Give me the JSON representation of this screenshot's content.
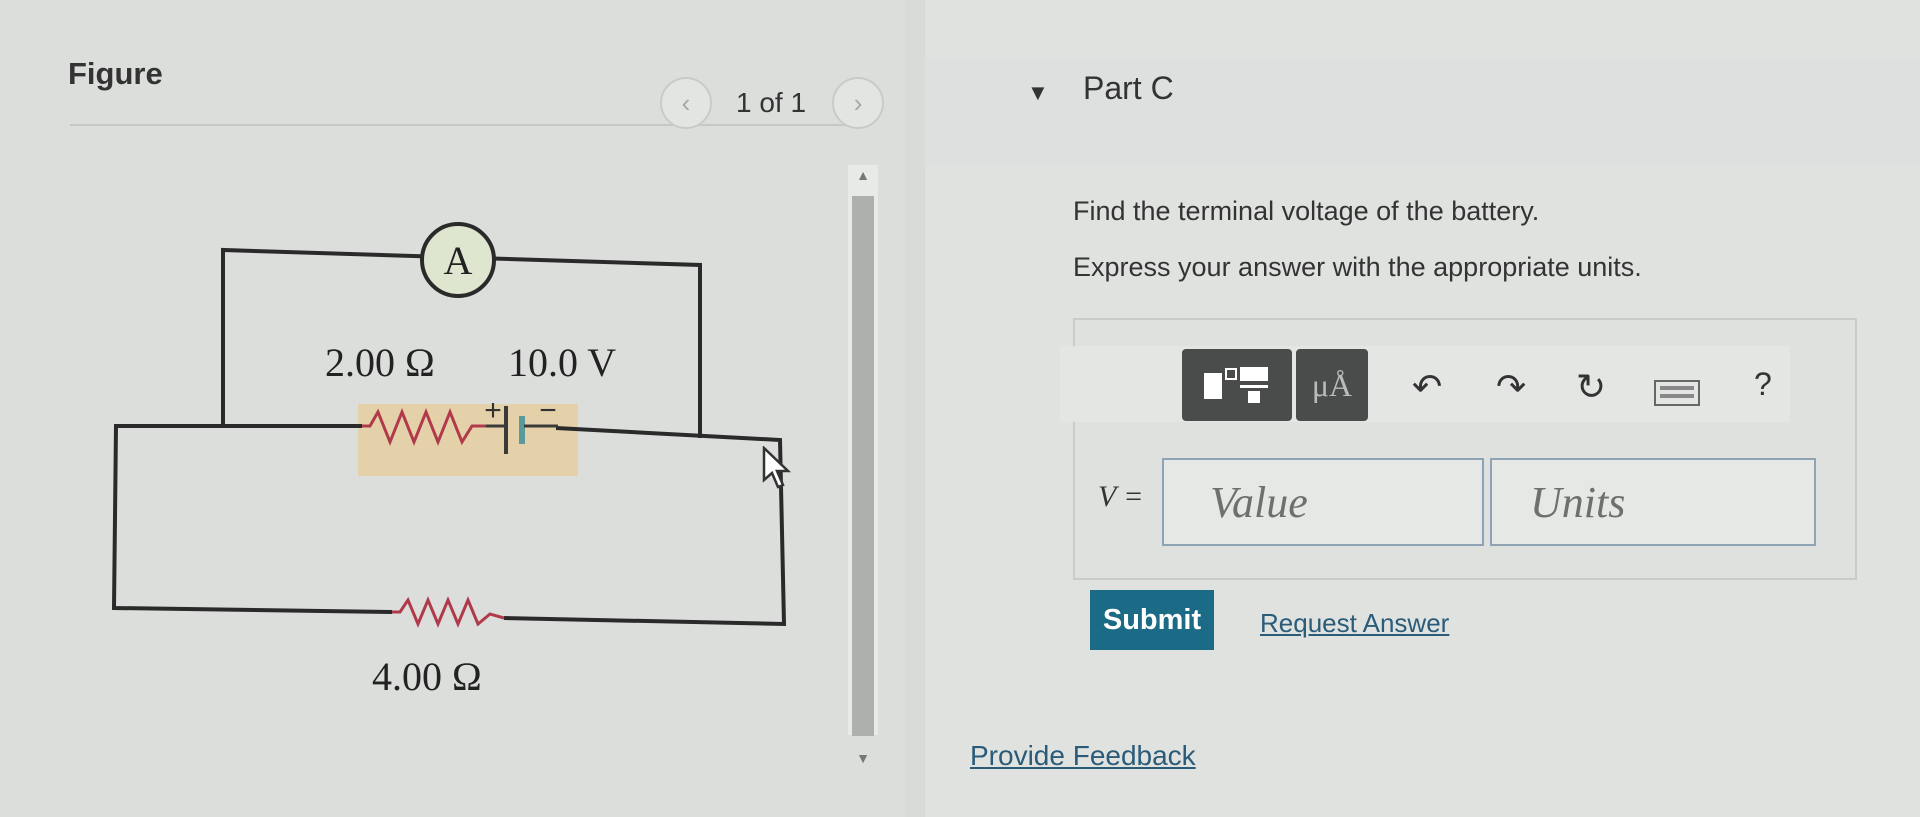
{
  "figure": {
    "title": "Figure",
    "pager": {
      "text": "1 of 1",
      "prev_icon": "chevron-left",
      "next_icon": "chevron-right"
    },
    "circuit": {
      "ammeter": "A",
      "internal_resistance": "2.00 Ω",
      "emf": "10.0 V",
      "plus": "+",
      "minus": "−",
      "load_resistance": "4.00 Ω"
    }
  },
  "question": {
    "part_title": "Part C",
    "prompt": "Find the terminal voltage of the battery.",
    "instruction": "Express your answer with the appropriate units.",
    "toolbar": {
      "template_icon": "fraction-template-icon",
      "units_label": "μÅ",
      "undo_icon": "undo-icon",
      "redo_icon": "redo-icon",
      "reset_icon": "reset-icon",
      "keyboard_icon": "keyboard-icon",
      "help_label": "?"
    },
    "variable_label": "V =",
    "value_placeholder": "Value",
    "units_placeholder": "Units",
    "submit_label": "Submit",
    "request_answer_label": "Request Answer"
  },
  "footer": {
    "feedback_label": "Provide Feedback"
  },
  "colors": {
    "submit_bg": "#1b6b86",
    "link": "#2a5c7a",
    "resistor": "#b03a4a",
    "highlight": "#e6cfa0"
  }
}
